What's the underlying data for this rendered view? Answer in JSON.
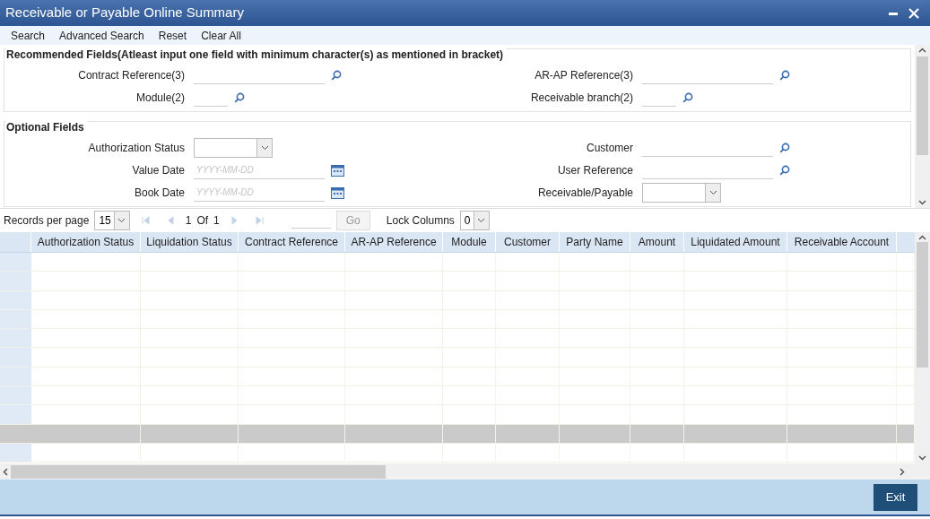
{
  "window": {
    "title": "Receivable or Payable Online Summary"
  },
  "toolbar": [
    "Search",
    "Advanced Search",
    "Reset",
    "Clear All"
  ],
  "recommended": {
    "title": "Recommended Fields(Atleast input one field with minimum character(s) as mentioned in bracket)",
    "fields": [
      {
        "label": "Contract Reference(3)",
        "kind": "lookup"
      },
      {
        "label": "AR-AP Reference(3)",
        "kind": "lookup"
      },
      {
        "label": "Module(2)",
        "kind": "code"
      },
      {
        "label": "Receivable branch(2)",
        "kind": "code"
      }
    ]
  },
  "optional": {
    "title": "Optional Fields",
    "fields": [
      {
        "label": "Authorization Status",
        "kind": "select"
      },
      {
        "label": "Customer",
        "kind": "lookup"
      },
      {
        "label": "Value Date",
        "kind": "date",
        "placeholder": "YYYY-MM-DD"
      },
      {
        "label": "User Reference",
        "kind": "lookup"
      },
      {
        "label": "Book Date",
        "kind": "date",
        "placeholder": "YYYY-MM-DD"
      },
      {
        "label": "Receivable/Payable",
        "kind": "select"
      }
    ]
  },
  "pager": {
    "records_label": "Records per page",
    "records_value": "15",
    "page": "1",
    "of": "Of",
    "total": "1",
    "go": "Go",
    "go_disabled": true,
    "lock_label": "Lock Columns",
    "lock_value": "0"
  },
  "table": {
    "columns": [
      "Authorization Status",
      "Liquidation Status",
      "Contract Reference",
      "AR-AP Reference",
      "Module",
      "Customer",
      "Party Name",
      "Amount",
      "Liquidated Amount",
      "Receivable Account"
    ],
    "rows": [
      {
        "selected": false
      },
      {
        "selected": false
      },
      {
        "selected": false
      },
      {
        "selected": false
      },
      {
        "selected": false
      },
      {
        "selected": false
      },
      {
        "selected": false
      },
      {
        "selected": false
      },
      {
        "selected": false
      },
      {
        "selected": true
      },
      {
        "selected": false
      }
    ]
  },
  "footer": {
    "button": "Exit"
  }
}
